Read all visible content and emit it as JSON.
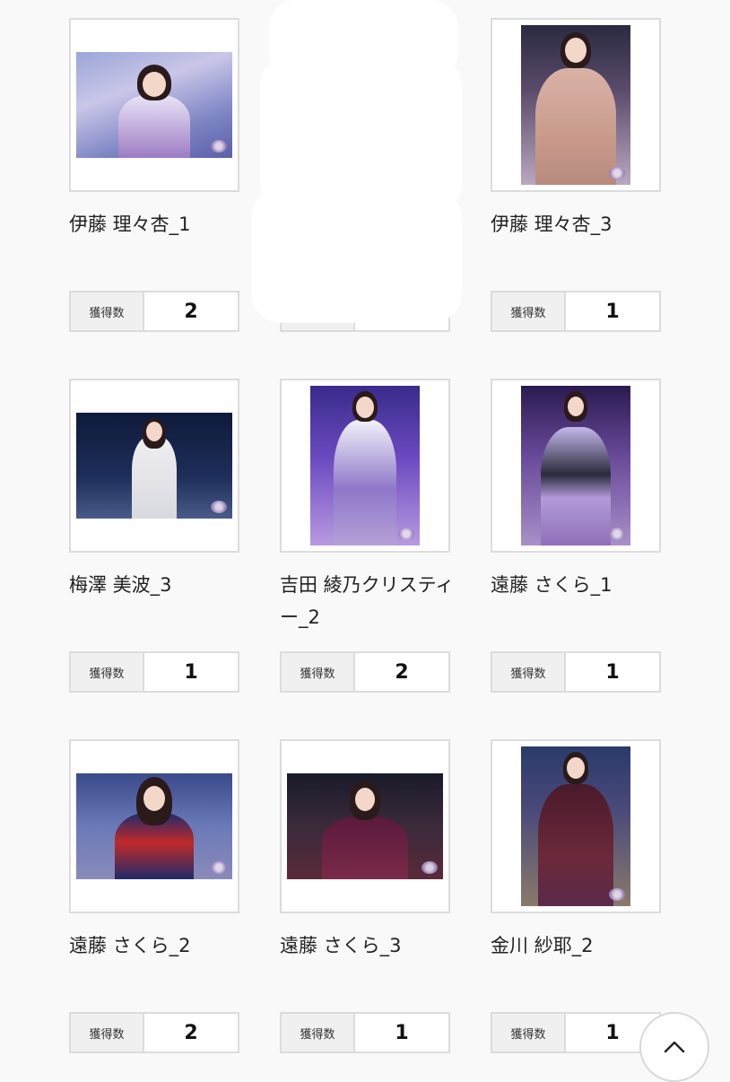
{
  "counter_label": "獲得数",
  "cards": [
    {
      "name": "伊藤 理々杏_1",
      "count": "2"
    },
    {
      "name": "",
      "count": ""
    },
    {
      "name": "伊藤 理々杏_3",
      "count": "1"
    },
    {
      "name": "梅澤 美波_3",
      "count": "1"
    },
    {
      "name": "吉田 綾乃クリスティー_2",
      "count": "2"
    },
    {
      "name": "遠藤 さくら_1",
      "count": "1"
    },
    {
      "name": "遠藤 さくら_2",
      "count": "2"
    },
    {
      "name": "遠藤 さくら_3",
      "count": "1"
    },
    {
      "name": "金川 紗耶_2",
      "count": "1"
    }
  ],
  "scroll_top_icon": "chevron-up-icon"
}
